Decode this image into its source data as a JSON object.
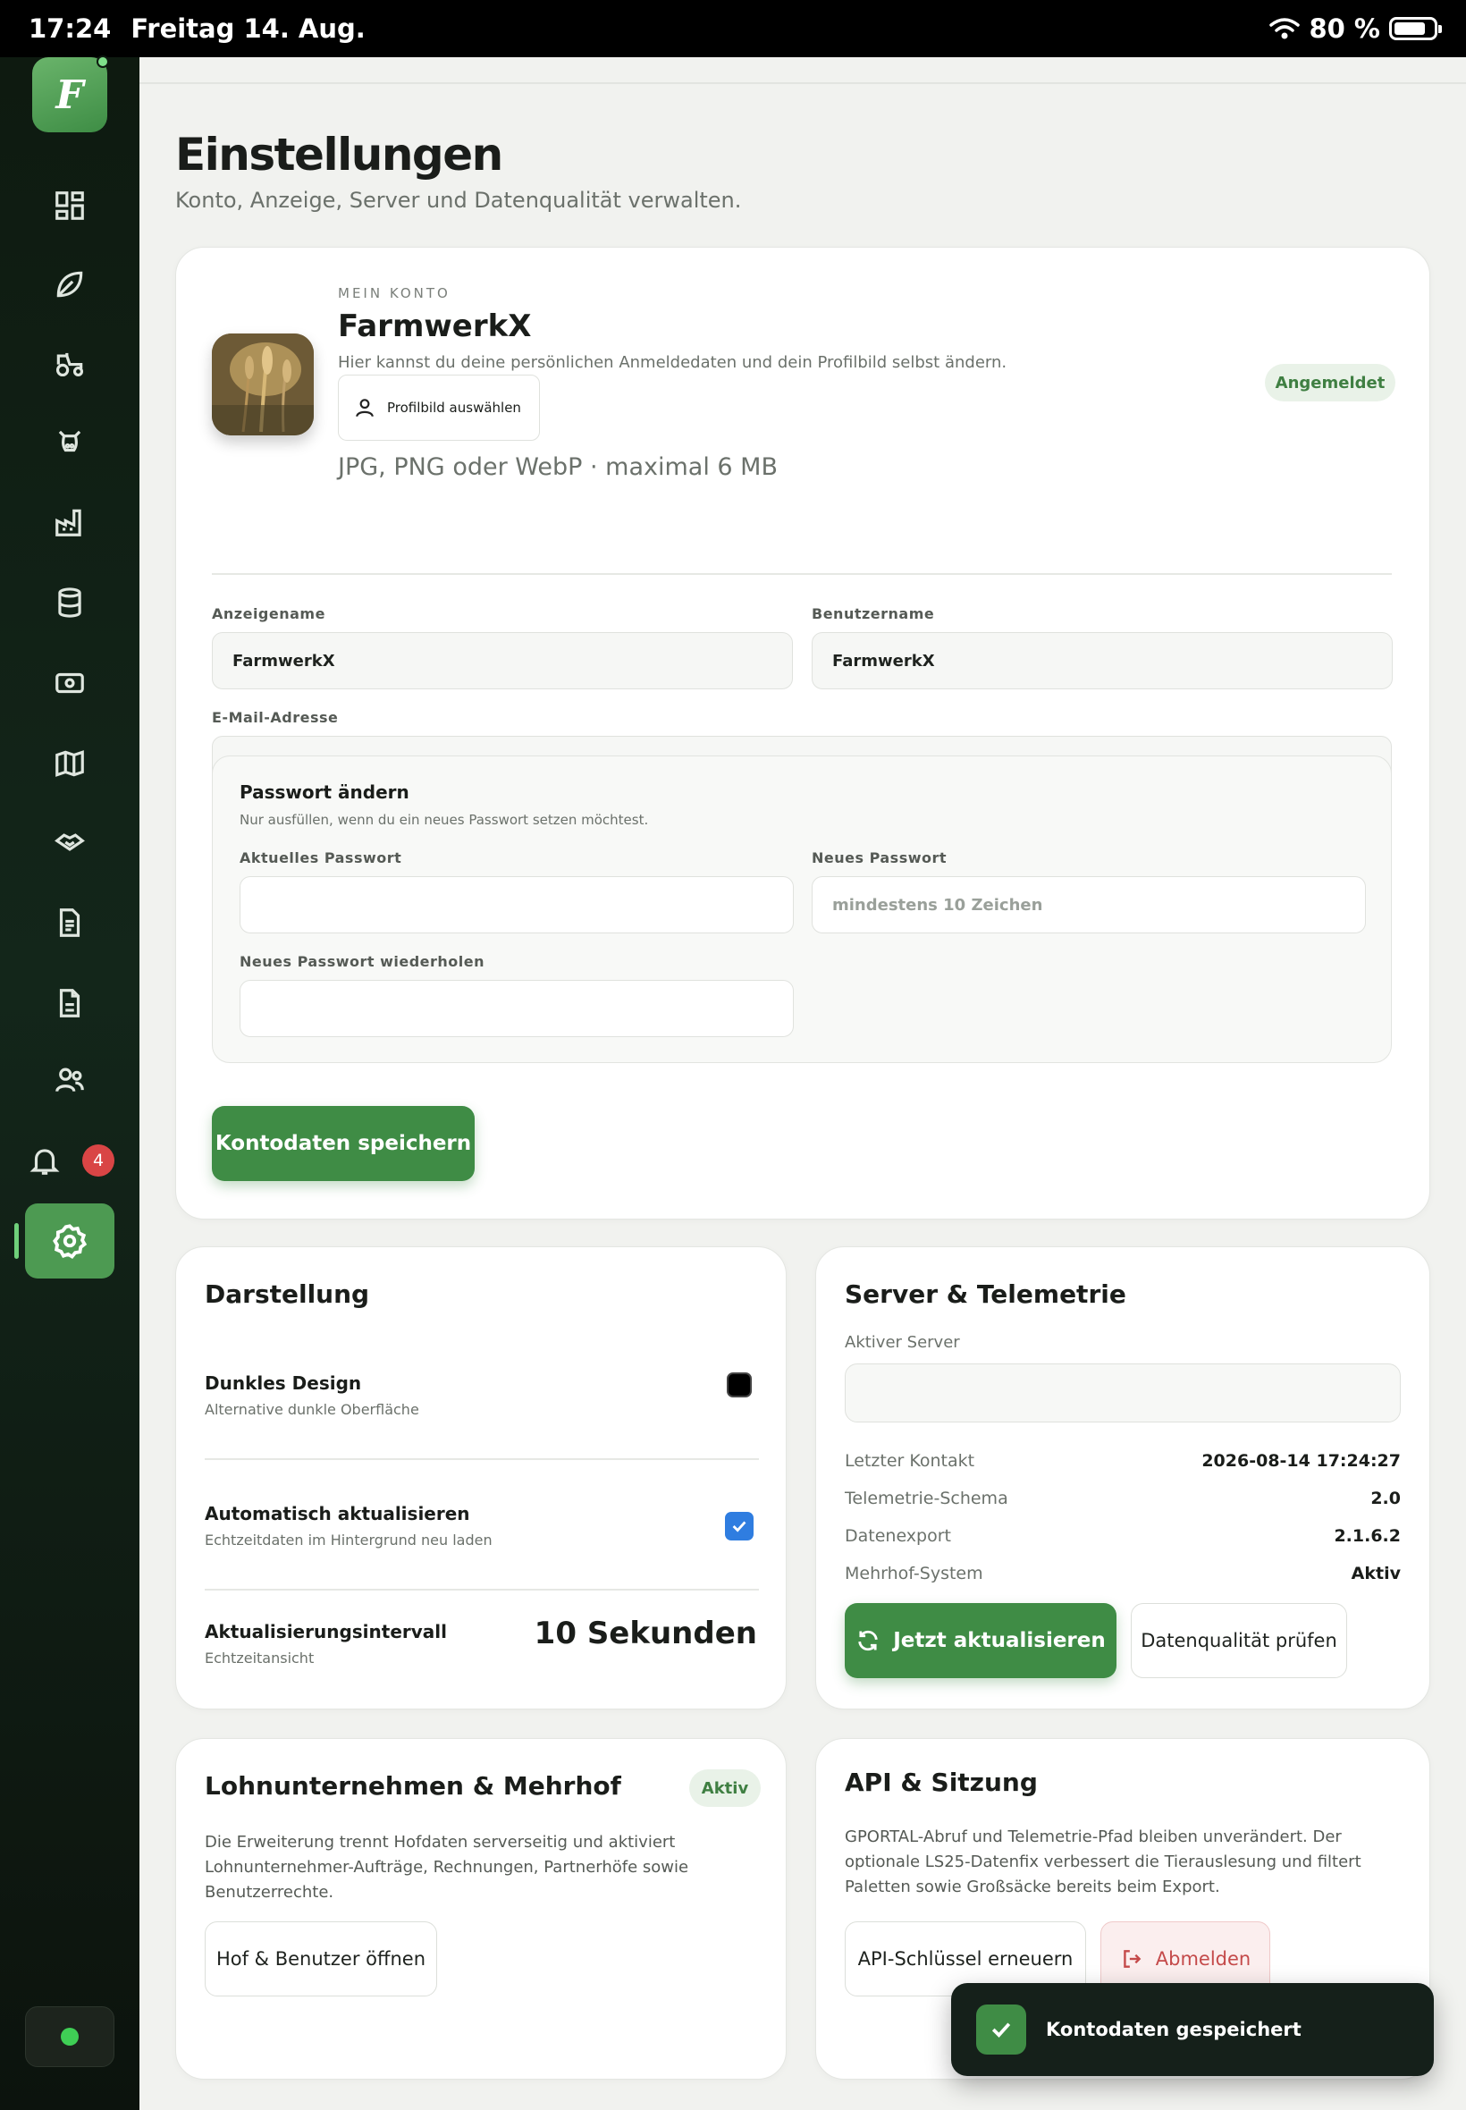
{
  "statusbar": {
    "time": "17:24",
    "date": "Freitag 14. Aug.",
    "battery": "80 %",
    "battery_level": 0.8
  },
  "sidebar": {
    "logo_letter": "F",
    "notification_count": "4",
    "items": [
      "dashboard-icon",
      "leaf-icon",
      "tractor-icon",
      "cow-icon",
      "factory-icon",
      "database-icon",
      "cash-icon",
      "map-icon",
      "handshake-icon",
      "document-icon",
      "invoice-icon",
      "users-icon",
      "bell-icon",
      "settings-icon"
    ]
  },
  "page": {
    "title": "Einstellungen",
    "subtitle": "Konto, Anzeige, Server und Datenqualität verwalten."
  },
  "account": {
    "kicker": "MEIN KONTO",
    "name": "FarmwerkX",
    "description": "Hier kannst du deine persönlichen Anmeldedaten und dein Profilbild selbst ändern.",
    "picture_button": "Profilbild auswählen",
    "picture_hint": "JPG, PNG oder WebP · maximal 6 MB",
    "status": "Angemeldet",
    "display_name_label": "Anzeigename",
    "display_name_value": "FarmwerkX",
    "username_label": "Benutzername",
    "username_value": "FarmwerkX",
    "email_label": "E-Mail-Adresse",
    "email_value": "",
    "password": {
      "title": "Passwort ändern",
      "subtitle": "Nur ausfüllen, wenn du ein neues Passwort setzen möchtest.",
      "current_label": "Aktuelles Passwort",
      "new_label": "Neues Passwort",
      "new_placeholder": "mindestens 10 Zeichen",
      "repeat_label": "Neues Passwort wiederholen"
    },
    "save_button": "Kontodaten speichern"
  },
  "display": {
    "title": "Darstellung",
    "dark_title": "Dunkles Design",
    "dark_sub": "Alternative dunkle Oberfläche",
    "auto_title": "Automatisch aktualisieren",
    "auto_sub": "Echtzeitdaten im Hintergrund neu laden",
    "interval_title": "Aktualisierungsintervall",
    "interval_sub": "Echtzeitansicht",
    "interval_value": "10 Sekunden"
  },
  "server": {
    "title": "Server & Telemetrie",
    "active_label": "Aktiver Server",
    "rows": [
      {
        "key": "Letzter Kontakt",
        "value": "2026-08-14 17:24:27"
      },
      {
        "key": "Telemetrie-Schema",
        "value": "2.0"
      },
      {
        "key": "Datenexport",
        "value": "2.1.6.2"
      },
      {
        "key": "Mehrhof-System",
        "value": "Aktiv"
      }
    ],
    "refresh_button": "Jetzt aktualisieren",
    "quality_button": "Datenqualität prüfen"
  },
  "contractor": {
    "title": "Lohnunternehmen & Mehrhof",
    "status": "Aktiv",
    "text": "Die Erweiterung trennt Hofdaten serverseitig und aktiviert Lohnunternehmer-Aufträge, Rechnungen, Partnerhöfe sowie Benutzerrechte.",
    "button": "Hof & Benutzer öffnen"
  },
  "api": {
    "title": "API & Sitzung",
    "text": "GPORTAL-Abruf und Telemetrie-Pfad bleiben unverändert. Der optionale LS25-Datenfix verbessert die Tierauslesung und filtert Paletten sowie Großsäcke bereits beim Export.",
    "renew_button": "API-Schlüssel erneuern",
    "logout_button": "Abmelden"
  },
  "toast": {
    "message": "Kontodaten gespeichert"
  }
}
